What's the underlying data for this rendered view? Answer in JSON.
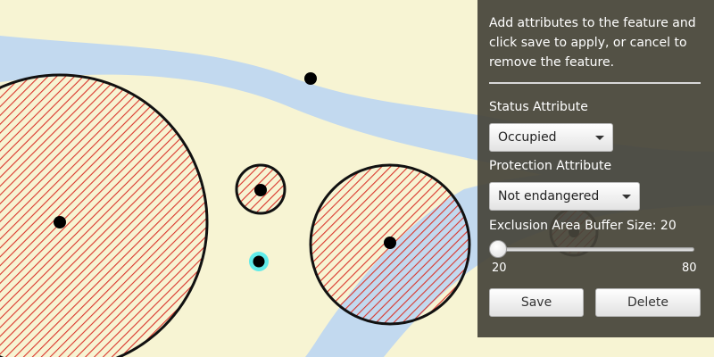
{
  "panel": {
    "intro_text": "Add attributes to the feature and click save to apply, or cancel to remove the feature.",
    "status_label": "Status Attribute",
    "status_value": "Occupied",
    "protection_label": "Protection Attribute",
    "protection_value": "Not endangered",
    "buffer_label": "Exclusion Area Buffer Size: 20",
    "slider": {
      "min_label": "20",
      "max_label": "80",
      "value": 20,
      "min": 20,
      "max": 80
    },
    "save_label": "Save",
    "delete_label": "Delete"
  },
  "colors": {
    "land": "#f7f4d3",
    "water": "#c2d9ef",
    "hatch": "#d9352b",
    "outline": "#111111",
    "selected_glow": "#2ee8f0",
    "panel_bg": "#46443a"
  }
}
